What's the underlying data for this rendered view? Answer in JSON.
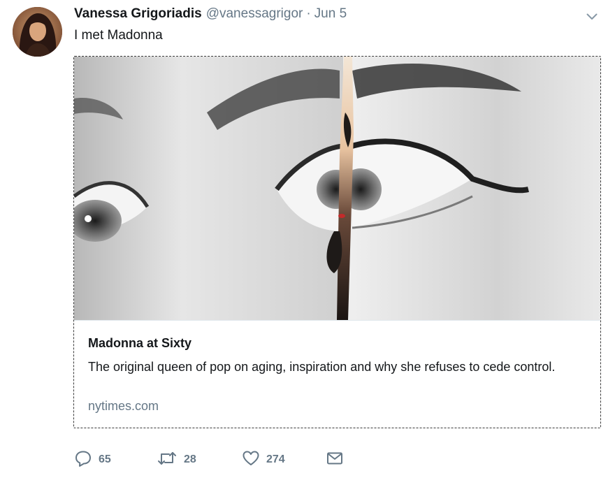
{
  "tweet": {
    "author": {
      "name": "Vanessa Grigoriadis",
      "handle": "@vanessagrigor",
      "avatar_icon": "user-avatar"
    },
    "separator": "·",
    "date": "Jun 5",
    "text": "I met Madonna",
    "menu_icon": "chevron-down-icon"
  },
  "card": {
    "title": "Madonna at Sixty",
    "description": "The original queen of pop on aging, inspiration and why she refuses to cede control.",
    "domain": "nytimes.com"
  },
  "actions": {
    "reply": {
      "icon": "reply-icon",
      "count": "65"
    },
    "retweet": {
      "icon": "retweet-icon",
      "count": "28"
    },
    "like": {
      "icon": "heart-icon",
      "count": "274"
    },
    "dm": {
      "icon": "envelope-icon"
    }
  },
  "colors": {
    "text": "#14171a",
    "secondary": "#657786",
    "border": "#e1e8ed"
  }
}
